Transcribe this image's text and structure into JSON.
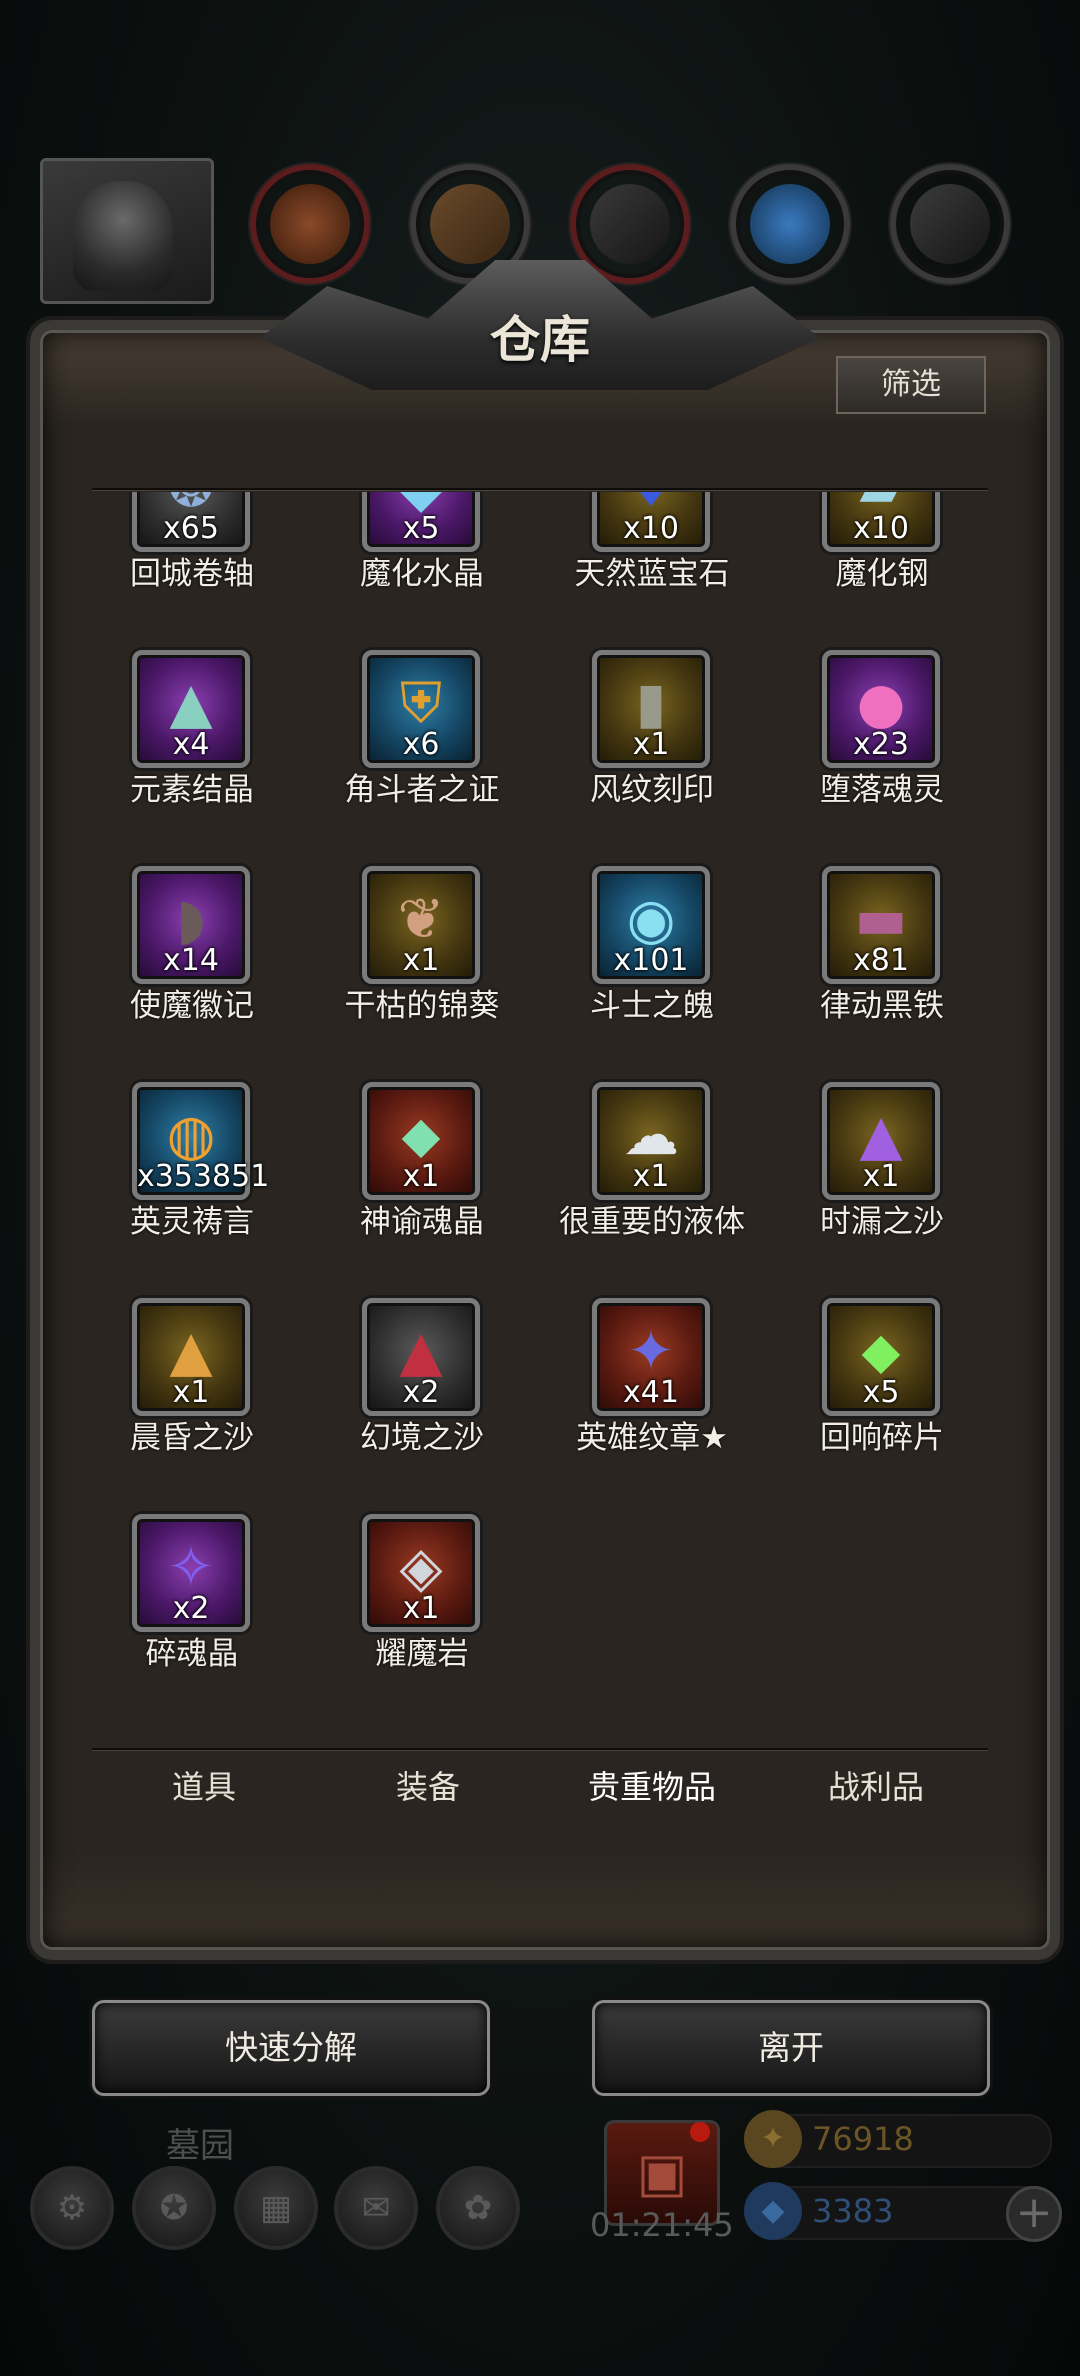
{
  "warehouse": {
    "title": "仓库",
    "filter_label": "筛选"
  },
  "items": [
    {
      "name": "回城卷轴",
      "count": "x65",
      "glyph": "❂",
      "frame": "grey",
      "icon": "swirl-scroll-icon"
    },
    {
      "name": "魔化水晶",
      "count": "x5",
      "glyph": "◆",
      "frame": "purple",
      "icon": "crystal-icon"
    },
    {
      "name": "天然蓝宝石",
      "count": "x10",
      "glyph": "♦",
      "frame": "gold",
      "icon": "sapphire-icon"
    },
    {
      "name": "魔化钢",
      "count": "x10",
      "glyph": "▰",
      "frame": "gold",
      "icon": "steel-ingot-icon"
    },
    {
      "name": "元素结晶",
      "count": "x4",
      "glyph": "▲",
      "frame": "purple",
      "icon": "crystal-pile-icon"
    },
    {
      "name": "角斗者之证",
      "count": "x6",
      "glyph": "⛨",
      "frame": "blue",
      "icon": "shield-emblem-icon"
    },
    {
      "name": "风纹刻印",
      "count": "x1",
      "glyph": "▮",
      "frame": "gold",
      "icon": "cloak-icon"
    },
    {
      "name": "堕落魂灵",
      "count": "x23",
      "glyph": "●",
      "frame": "purple",
      "icon": "soul-orb-icon"
    },
    {
      "name": "使魔徽记",
      "count": "x14",
      "glyph": "◗",
      "frame": "purple",
      "icon": "gauntlet-icon"
    },
    {
      "name": "干枯的锦葵",
      "count": "x1",
      "glyph": "❦",
      "frame": "gold",
      "icon": "dried-flower-icon"
    },
    {
      "name": "斗士之魄",
      "count": "x101",
      "glyph": "◉",
      "frame": "blue",
      "icon": "spirit-flame-icon"
    },
    {
      "name": "律动黑铁",
      "count": "x81",
      "glyph": "▬",
      "frame": "gold",
      "icon": "iron-bar-icon"
    },
    {
      "name": "英灵祷言",
      "count": "x353851",
      "glyph": "◍",
      "frame": "blue",
      "icon": "golden-orb-icon"
    },
    {
      "name": "神谕魂晶",
      "count": "x1",
      "glyph": "⬥",
      "frame": "red",
      "icon": "green-crystal-icon"
    },
    {
      "name": "很重要的液体",
      "count": "x1",
      "glyph": "☁",
      "frame": "gold",
      "icon": "liquid-splash-icon"
    },
    {
      "name": "时漏之沙",
      "count": "x1",
      "glyph": "▲",
      "frame": "gold",
      "icon": "sand-pile-icon"
    },
    {
      "name": "晨昏之沙",
      "count": "x1",
      "glyph": "▲",
      "frame": "gold",
      "icon": "sand-pile-icon"
    },
    {
      "name": "幻境之沙",
      "count": "x2",
      "glyph": "▲",
      "frame": "grey",
      "icon": "sand-pile-icon"
    },
    {
      "name": "英雄纹章★",
      "count": "x41",
      "glyph": "✦",
      "frame": "red",
      "icon": "hero-badge-icon"
    },
    {
      "name": "回响碎片",
      "count": "x5",
      "glyph": "⬥",
      "frame": "gold",
      "icon": "shard-icon"
    },
    {
      "name": "碎魂晶",
      "count": "x2",
      "glyph": "✧",
      "frame": "purple",
      "icon": "purple-crystals-icon"
    },
    {
      "name": "耀魔岩",
      "count": "x1",
      "glyph": "◈",
      "frame": "red",
      "icon": "rock-crystal-icon"
    }
  ],
  "tabs": [
    "道具",
    "装备",
    "贵重物品",
    "战利品"
  ],
  "active_tab": "贵重物品",
  "actions": {
    "decompose": "快速分解",
    "leave": "离开"
  },
  "bottom": {
    "location": "墓园",
    "timer": "01:21:45",
    "gold": "76918",
    "gems": "3383"
  },
  "colors": {
    "gold_text": "#6a5526",
    "gem_text": "#2f4f78"
  }
}
